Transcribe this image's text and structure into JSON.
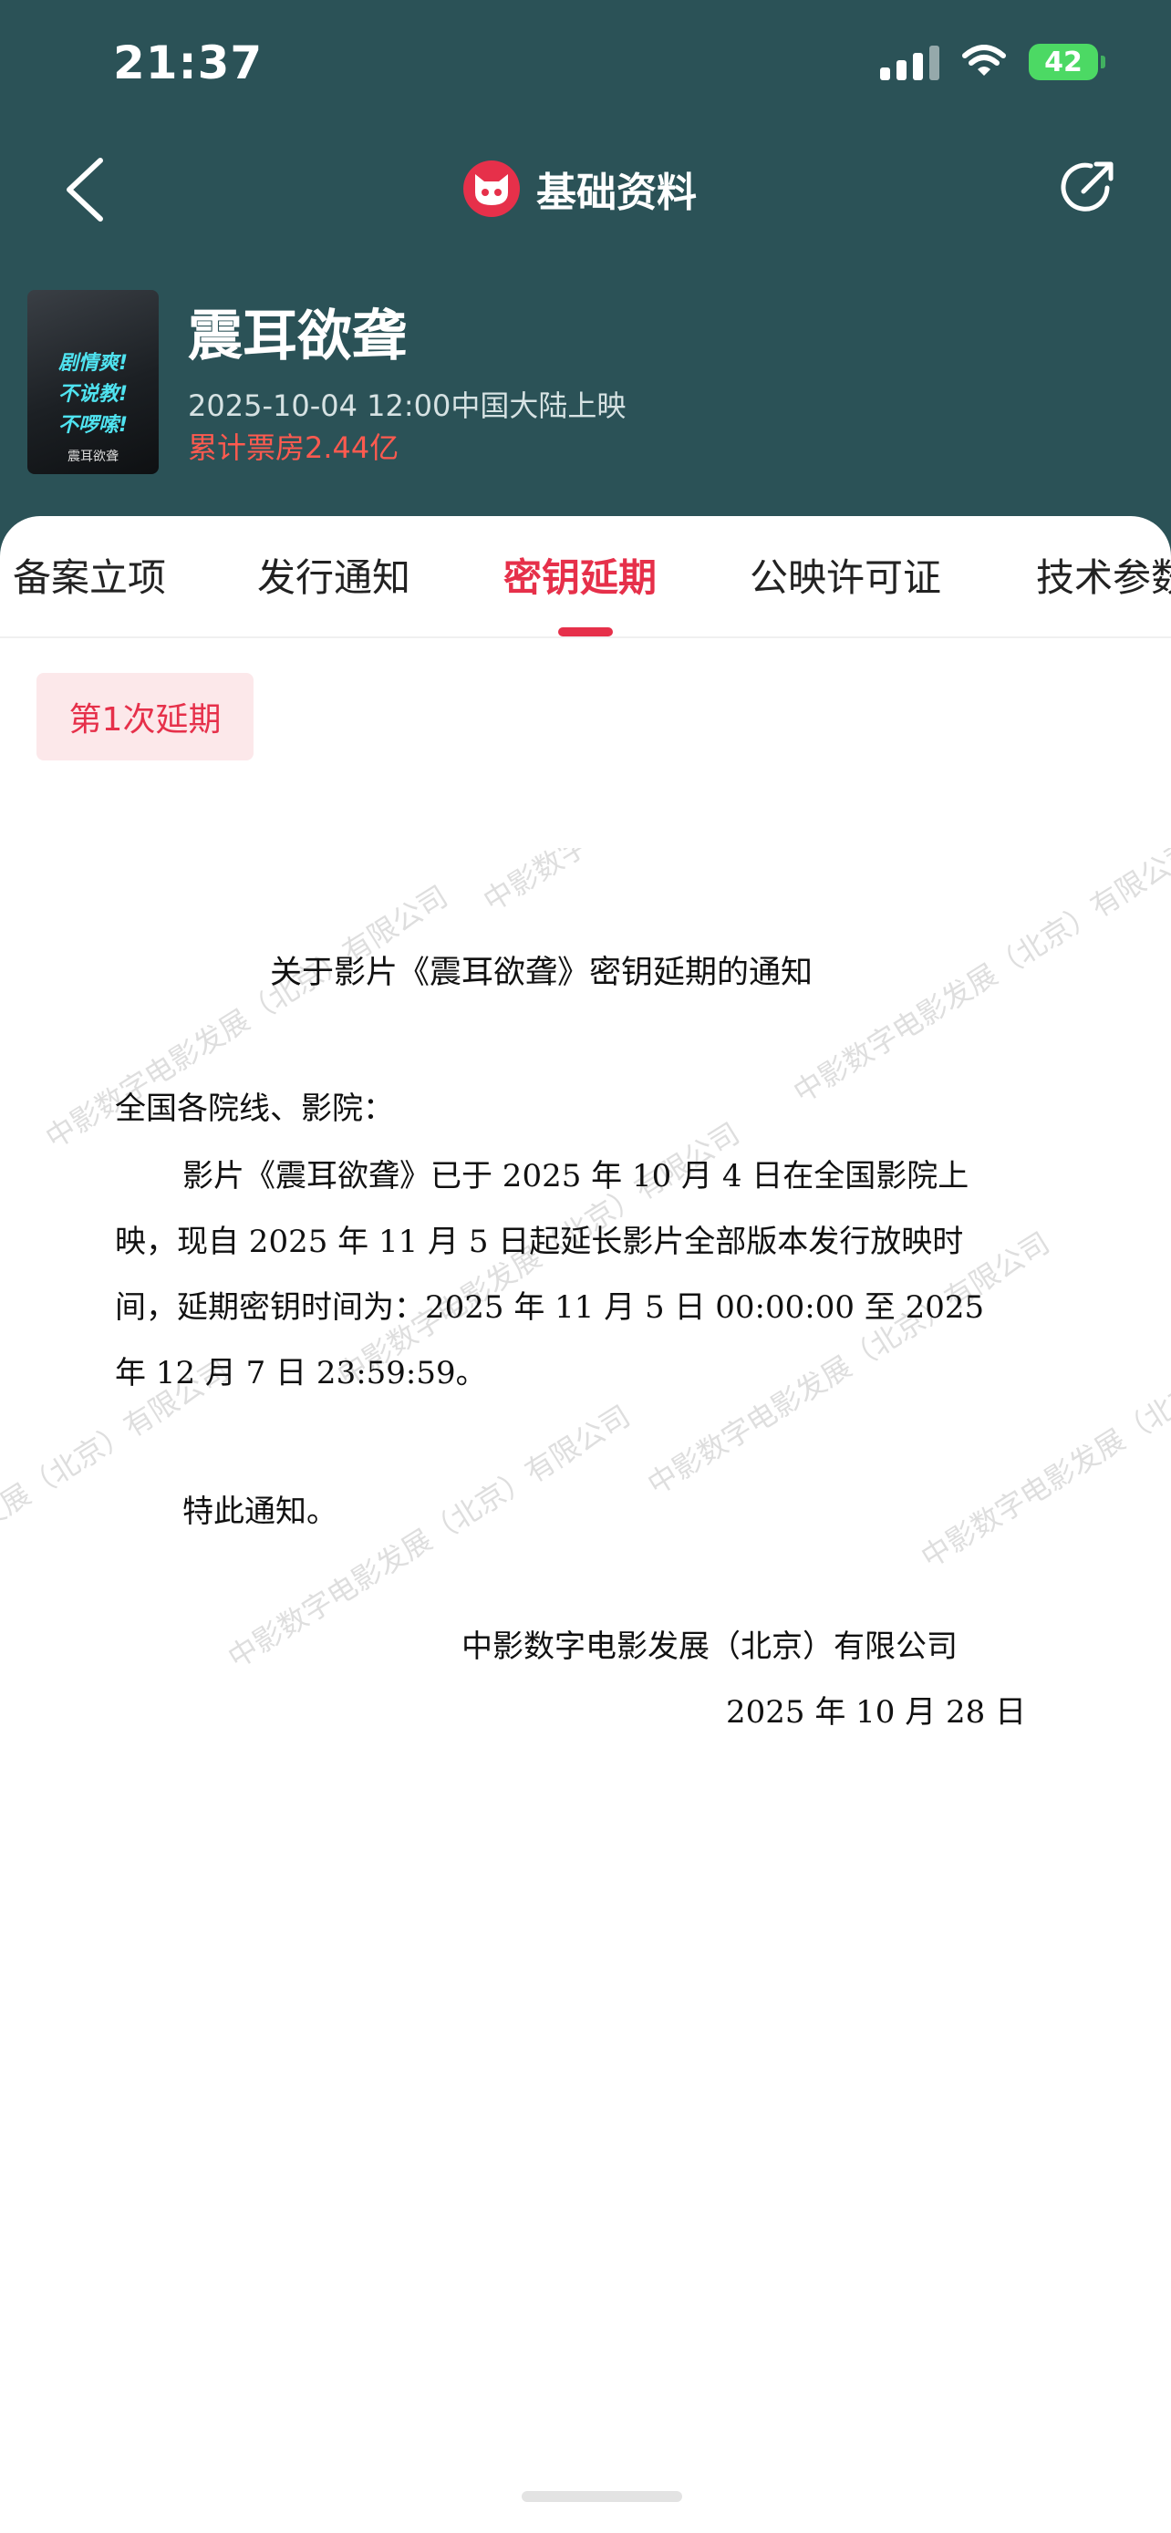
{
  "status_bar": {
    "time": "21:37",
    "battery": "42"
  },
  "nav": {
    "title": "基础资料"
  },
  "movie": {
    "poster_lines": [
      "剧情爽!",
      "不说教!",
      "不啰嗦!"
    ],
    "poster_title": "震耳欲聋",
    "title": "震耳欲聋",
    "release": "2025-10-04 12:00中国大陆上映",
    "box_office": "累计票房2.44亿"
  },
  "tabs": [
    "备案立项",
    "发行通知",
    "密钥延期",
    "公映许可证",
    "技术参数"
  ],
  "active_tab": "密钥延期",
  "extension_chip": "第1次延期",
  "document": {
    "title": "关于影片《震耳欲聋》密钥延期的通知",
    "salutation": "全国各院线、影院：",
    "body_lines": [
      "影片《震耳欲聋》已于 2025 年 10 月 4 日在全国影院上",
      "映，现自 2025 年 11 月 5 日起延长影片全部版本发行放映时",
      "间，延期密钥时间为：2025 年 11 月 5 日 00:00:00 至 2025",
      "年 12 月 7 日 23:59:59。"
    ],
    "closing": "特此通知。",
    "issuer": "中影数字电影发展（北京）有限公司",
    "date": "2025 年 10 月 28 日",
    "watermark": "中影数字电影发展（北京）有限公司"
  },
  "colors": {
    "header_bg": "#2b5257",
    "accent": "#e6304a",
    "box_office": "#ff5a4f"
  }
}
